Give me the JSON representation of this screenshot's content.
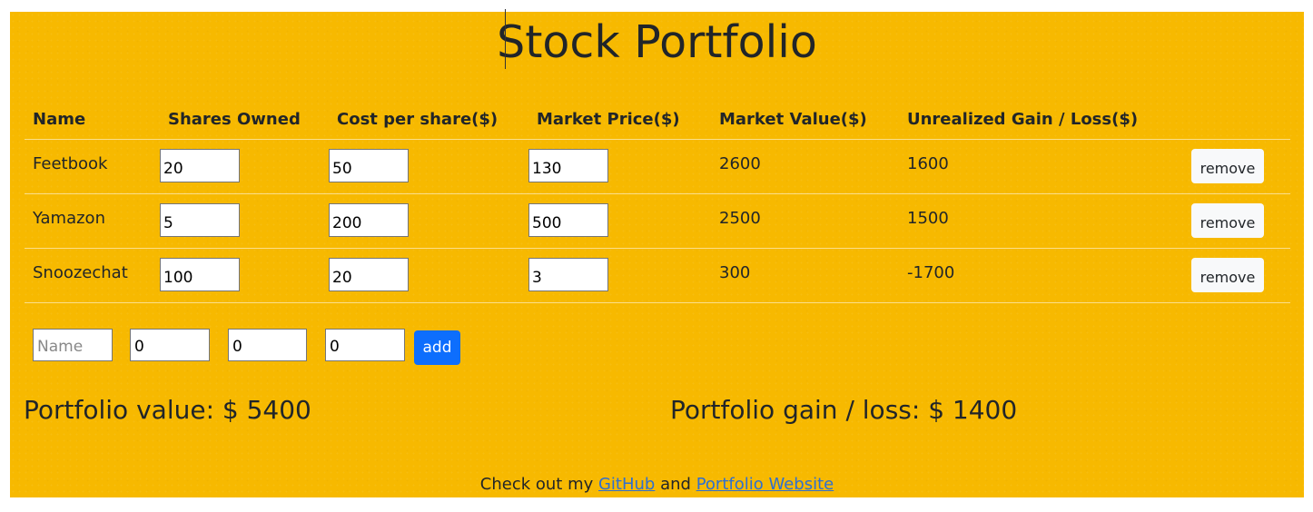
{
  "app": {
    "title": "Stock Portfolio"
  },
  "table": {
    "headers": [
      "Name",
      "Shares Owned",
      "Cost per share($)",
      "Market Price($)",
      "Market Value($)",
      "Unrealized Gain / Loss($)"
    ],
    "rows": [
      {
        "name": "Feetbook",
        "shares": "20",
        "cost": "50",
        "price": "130",
        "value": "2600",
        "gain": "1600",
        "remove_label": "remove"
      },
      {
        "name": "Yamazon",
        "shares": "5",
        "cost": "200",
        "price": "500",
        "value": "2500",
        "gain": "1500",
        "remove_label": "remove"
      },
      {
        "name": "Snoozechat",
        "shares": "100",
        "cost": "20",
        "price": "3",
        "value": "300",
        "gain": "-1700",
        "remove_label": "remove"
      }
    ]
  },
  "add_form": {
    "name_placeholder": "Name",
    "shares_value": "0",
    "cost_value": "0",
    "price_value": "0",
    "add_label": "add"
  },
  "summary": {
    "portfolio_value": "Portfolio value: $ 5400",
    "portfolio_gain": "Portfolio gain / loss: $ 1400"
  },
  "footer": {
    "prefix": "Check out my ",
    "github_label": "GitHub",
    "middle": " and ",
    "website_label": "Portfolio Website"
  },
  "colors": {
    "background": "#f7b900",
    "add_button": "#0d6efd",
    "link": "#2f6fd1"
  }
}
